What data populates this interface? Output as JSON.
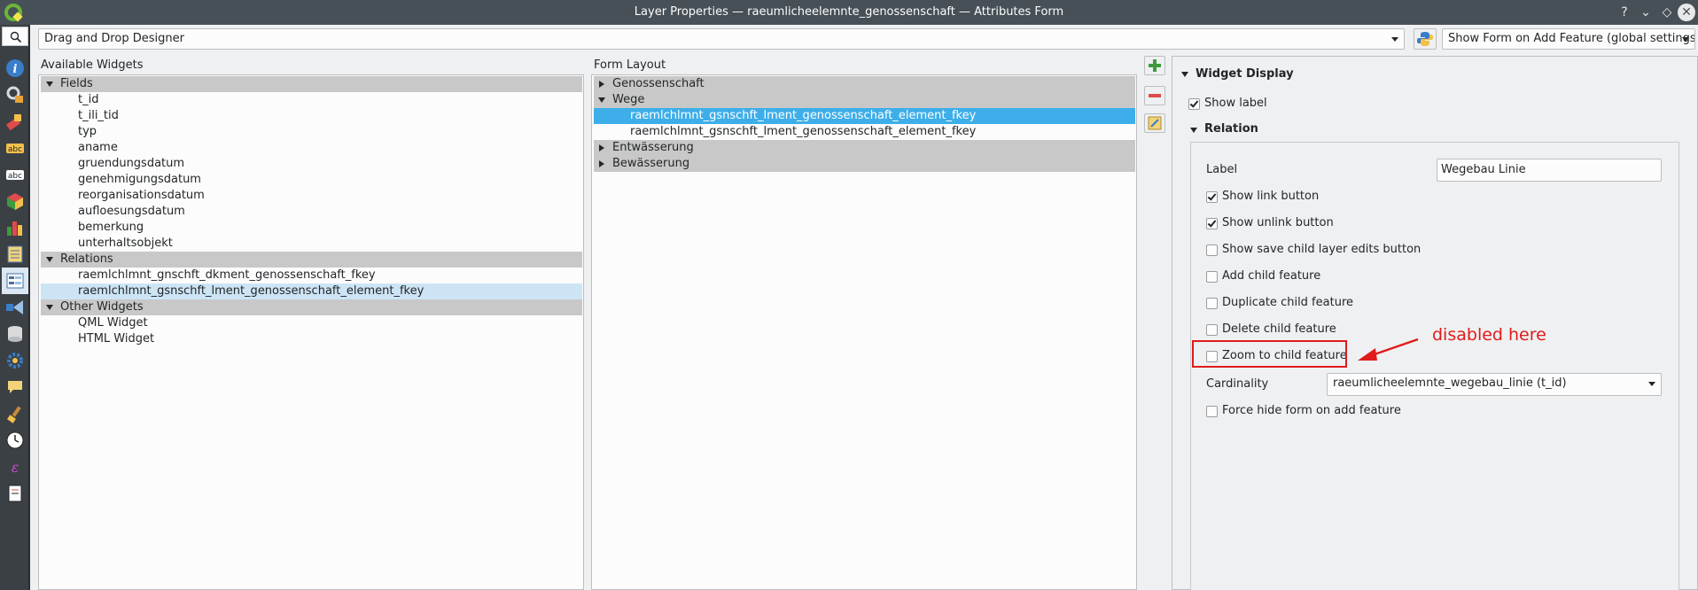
{
  "window": {
    "title": "Layer Properties — raeumlicheelemnte_genossenschaft — Attributes Form",
    "buttons": [
      "?",
      "⌄",
      "◇",
      "✕"
    ]
  },
  "toolbar": {
    "designer_mode": "Drag and Drop Designer",
    "show_form_mode": "Show Form on Add Feature (global settings)"
  },
  "available_widgets": {
    "header": "Available Widgets",
    "groups": [
      {
        "label": "Fields",
        "items": [
          "t_id",
          "t_ili_tid",
          "typ",
          "aname",
          "gruendungsdatum",
          "genehmigungsdatum",
          "reorganisationsdatum",
          "aufloesungsdatum",
          "bemerkung",
          "unterhaltsobjekt"
        ]
      },
      {
        "label": "Relations",
        "items": [
          "raemlchlmnt_gnschft_dkment_genossenschaft_fkey",
          "raemlchlmnt_gsnschft_lment_genossenschaft_element_fkey"
        ]
      },
      {
        "label": "Other Widgets",
        "items": [
          "QML Widget",
          "HTML Widget"
        ]
      }
    ]
  },
  "form_layout": {
    "header": "Form Layout",
    "nodes": [
      {
        "label": "Genossenschaft"
      },
      {
        "label": "Wege",
        "children": [
          "raemlchlmnt_gsnschft_lment_genossenschaft_element_fkey",
          "raemlchlmnt_gsnschft_lment_genossenschaft_element_fkey"
        ]
      },
      {
        "label": "Entwässerung"
      },
      {
        "label": "Bewässerung"
      }
    ]
  },
  "widget_display": {
    "header": "Widget Display",
    "show_label": "Show label",
    "relation_header": "Relation",
    "label_caption": "Label",
    "label_value": "Wegebau Linie",
    "options": [
      {
        "label": "Show link button",
        "checked": true
      },
      {
        "label": "Show unlink button",
        "checked": true
      },
      {
        "label": "Show save child layer edits button",
        "checked": false
      },
      {
        "label": "Add child feature",
        "checked": false
      },
      {
        "label": "Duplicate child feature",
        "checked": false
      },
      {
        "label": "Delete child feature",
        "checked": false
      },
      {
        "label": "Zoom to child feature",
        "checked": false
      }
    ],
    "cardinality_caption": "Cardinality",
    "cardinality_value": "raeumlicheelemnte_wegebau_linie (t_id)",
    "force_hide": "Force hide form on add feature"
  },
  "annotation": {
    "text": "disabled here",
    "color": "#e01b1b"
  },
  "sidebar_icons": [
    "search-icon",
    "information-icon",
    "source-icon",
    "symbology-icon",
    "labels-icon",
    "masks-icon",
    "3d-view-icon",
    "diagrams-icon",
    "fields-icon",
    "attributes-form-icon",
    "joins-icon",
    "auxiliary-storage-icon",
    "actions-icon",
    "display-icon",
    "rendering-icon",
    "temporal-icon",
    "variables-icon",
    "metadata-icon"
  ]
}
